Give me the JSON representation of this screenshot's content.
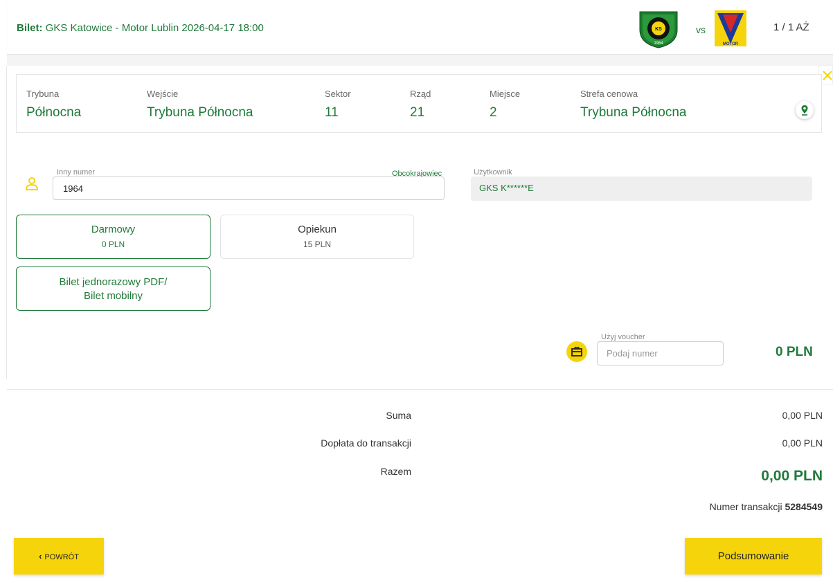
{
  "header": {
    "title_prefix": "Bilet:",
    "title_event": "GKS Katowice - Motor Lublin 2026-04-17 18:00",
    "vs": "vs",
    "pager": "1 / 1",
    "sort_label": "AŻ",
    "home_logo_year": "1964",
    "away_logo_text": "MOTOR"
  },
  "seat": {
    "fields": [
      {
        "label": "Trybuna",
        "value": "Północna"
      },
      {
        "label": "Wejście",
        "value": "Trybuna Północna"
      },
      {
        "label": "Sektor",
        "value": "11"
      },
      {
        "label": "Rząd",
        "value": "21"
      },
      {
        "label": "Miejsce",
        "value": "2"
      },
      {
        "label": "Strefa cenowa",
        "value": "Trybuna Północna"
      }
    ]
  },
  "form": {
    "number_label": "Inny numer",
    "number_value": "1964",
    "foreigner_link": "Obcokrajowiec",
    "user_label": "Użytkownik",
    "user_value": "GKS K******E"
  },
  "ticket_options": [
    {
      "name": "Darmowy",
      "price": "0 PLN",
      "selected": true
    },
    {
      "name": "Opiekun",
      "price": "15 PLN",
      "selected": false
    }
  ],
  "delivery_option": {
    "line1": "Bilet jednorazowy PDF/",
    "line2": "Bilet mobilny",
    "selected": true
  },
  "voucher": {
    "label": "Użyj voucher",
    "placeholder": "Podaj numer"
  },
  "item_total": "0 PLN",
  "summary": {
    "sum_label": "Suma",
    "sum_value": "0,00 PLN",
    "fee_label": "Dopłata do transakcji",
    "fee_value": "0,00 PLN",
    "total_label": "Razem",
    "total_value": "0,00 PLN",
    "transaction_label": "Numer transakcji",
    "transaction_number": "5284549"
  },
  "buttons": {
    "back": "POWRÓT",
    "summary": "Podsumowanie"
  },
  "colors": {
    "brand_green": "#1f7a3a",
    "accent_yellow": "#f6d40c"
  }
}
